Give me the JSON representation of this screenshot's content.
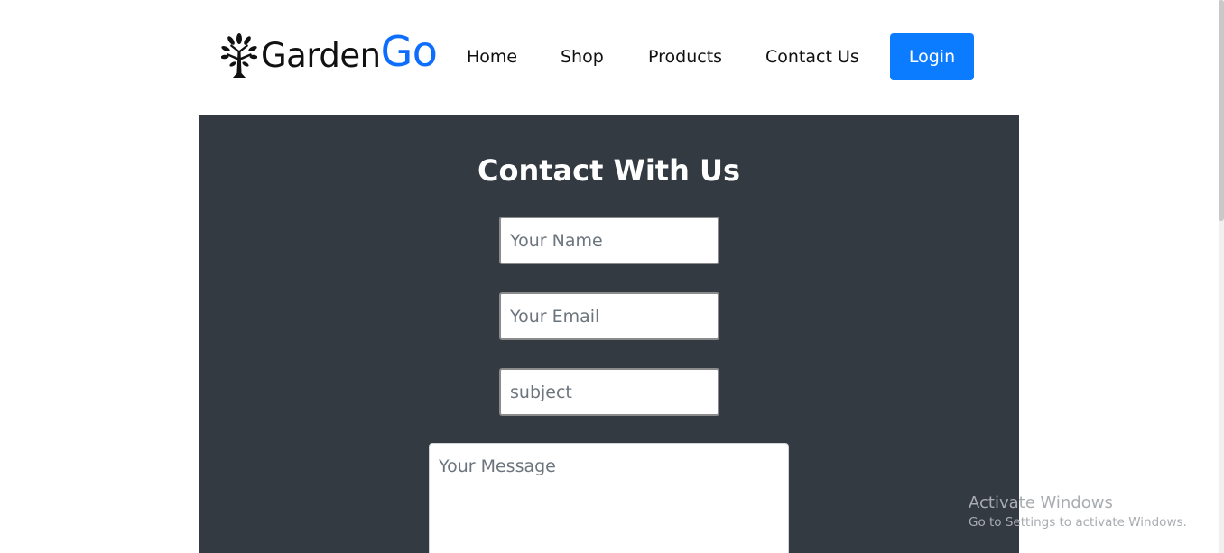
{
  "brand": {
    "name": "Garden",
    "accent": "Go",
    "logo_icon": "tree-icon",
    "accent_color": "#0d6efd"
  },
  "nav": {
    "items": [
      {
        "label": "Home"
      },
      {
        "label": "Shop"
      },
      {
        "label": "Products"
      },
      {
        "label": "Contact Us"
      }
    ],
    "login_label": "Login",
    "login_color": "#0b7bff"
  },
  "contact": {
    "title": "Contact With Us",
    "background": "#343a42",
    "name_placeholder": "Your Name",
    "email_placeholder": "Your Email",
    "subject_placeholder": "subject",
    "message_placeholder": "Your Message"
  },
  "watermark": {
    "title": "Activate Windows",
    "subtitle": "Go to Settings to activate Windows."
  }
}
